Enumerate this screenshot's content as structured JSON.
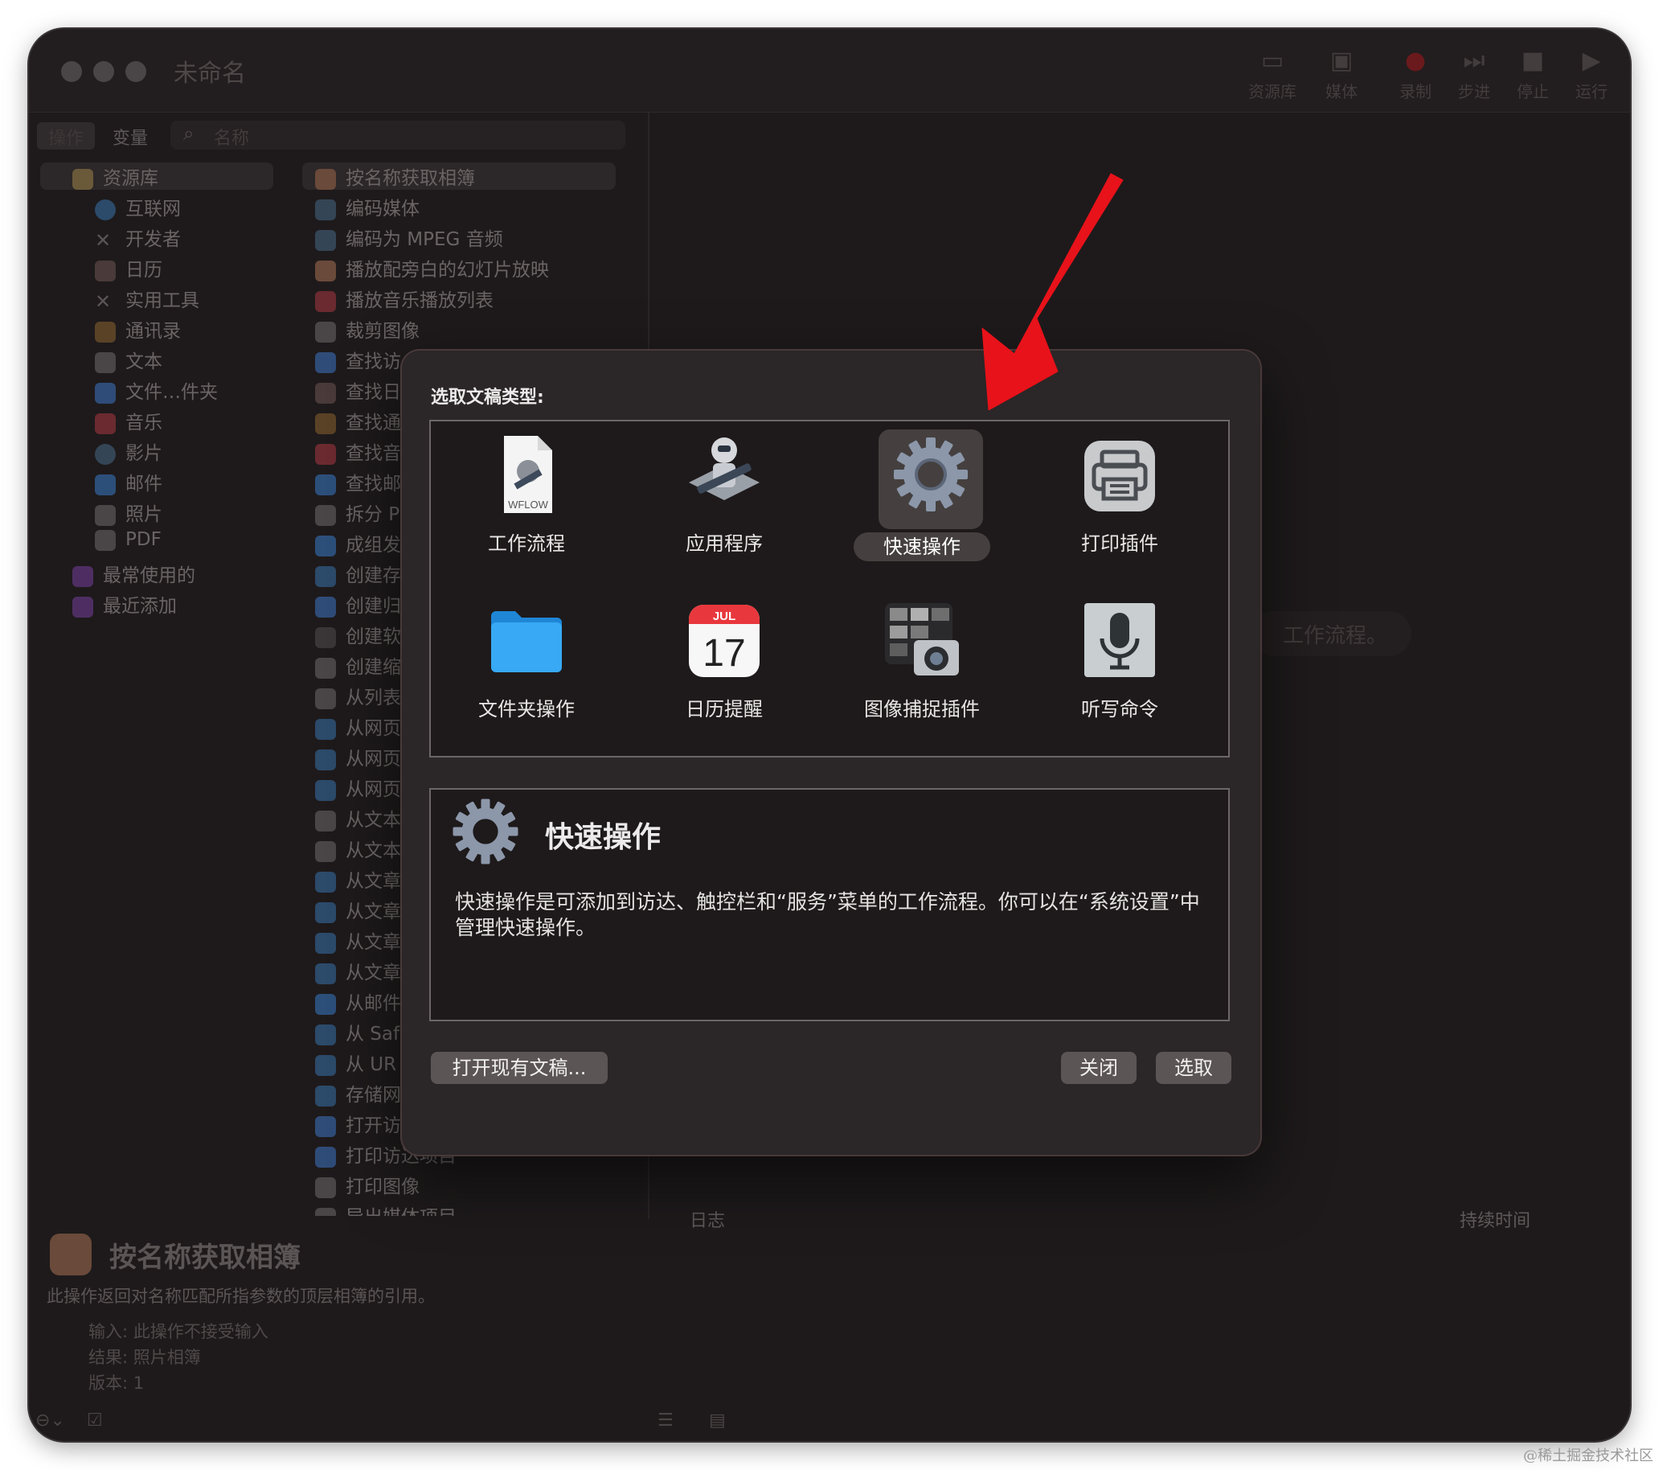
{
  "window": {
    "title": "未命名"
  },
  "toolbar": {
    "buttons": [
      {
        "label": "资源库",
        "icon": "library-panel-icon"
      },
      {
        "label": "媒体",
        "icon": "media-icon"
      },
      {
        "label": "录制",
        "icon": "record-icon"
      },
      {
        "label": "步进",
        "icon": "step-icon"
      },
      {
        "label": "停止",
        "icon": "stop-icon"
      },
      {
        "label": "运行",
        "icon": "run-icon"
      }
    ]
  },
  "library_tabs": {
    "actions": "操作",
    "variables": "变量"
  },
  "search": {
    "placeholder": "名称"
  },
  "library": {
    "root": "资源库",
    "items": [
      "互联网",
      "开发者",
      "日历",
      "实用工具",
      "通讯录",
      "文本",
      "文件…件夹",
      "音乐",
      "影片",
      "邮件",
      "照片",
      "PDF"
    ],
    "groups": [
      "最常使用的",
      "最近添加"
    ]
  },
  "actions": [
    "按名称获取相簿",
    "编码媒体",
    "编码为 MPEG 音频",
    "播放配旁白的幻灯片放映",
    "播放音乐播放列表",
    "裁剪图像",
    "查找访",
    "查找日",
    "查找通",
    "查找音",
    "查找邮",
    "拆分 P",
    "成组发",
    "创建存",
    "创建归",
    "创建软",
    "创建缩",
    "从列表",
    "从网页",
    "从网页",
    "从网页",
    "从文本",
    "从文本",
    "从文章",
    "从文章",
    "从文章",
    "从文章",
    "从邮件",
    "从 Saf",
    "从 UR",
    "存储网",
    "打开访达项目",
    "打印访达项目",
    "打印图像",
    "导出媒体项目"
  ],
  "detail": {
    "title": "按名称获取相簿",
    "description": "此操作返回对名称匹配所指参数的顶层相簿的引用。",
    "input_label": "输入:",
    "input_value": "此操作不接受输入",
    "result_label": "结果:",
    "result_value": "照片相簿",
    "version_label": "版本:",
    "version_value": "1"
  },
  "log": {
    "column_log": "日志",
    "column_duration": "持续时间"
  },
  "background_hint": "工作流程。",
  "dialog": {
    "prompt": "选取文稿类型:",
    "types": [
      {
        "label": "工作流程",
        "icon": "workflow-document-icon",
        "badge": "WFLOW"
      },
      {
        "label": "应用程序",
        "icon": "automator-robot-icon"
      },
      {
        "label": "快速操作",
        "icon": "gear-icon"
      },
      {
        "label": "打印插件",
        "icon": "printer-icon"
      },
      {
        "label": "文件夹操作",
        "icon": "folder-icon"
      },
      {
        "label": "日历提醒",
        "icon": "calendar-icon",
        "month": "JUL",
        "day": "17"
      },
      {
        "label": "图像捕捉插件",
        "icon": "image-capture-icon"
      },
      {
        "label": "听写命令",
        "icon": "microphone-icon"
      }
    ],
    "selected": "快速操作",
    "info_title": "快速操作",
    "info_description": "快速操作是可添加到访达、触控栏和“服务”菜单的工作流程。你可以在“系统设置”中管理快速操作。",
    "open_existing": "打开现有文稿...",
    "close": "关闭",
    "choose": "选取"
  },
  "watermark": "@稀土掘金技术社区",
  "colors": {
    "window_bg": "#1e1a1b",
    "dialog_bg": "#2b2627",
    "arrow": "#e8121a",
    "folder": "#2ea3f2"
  }
}
